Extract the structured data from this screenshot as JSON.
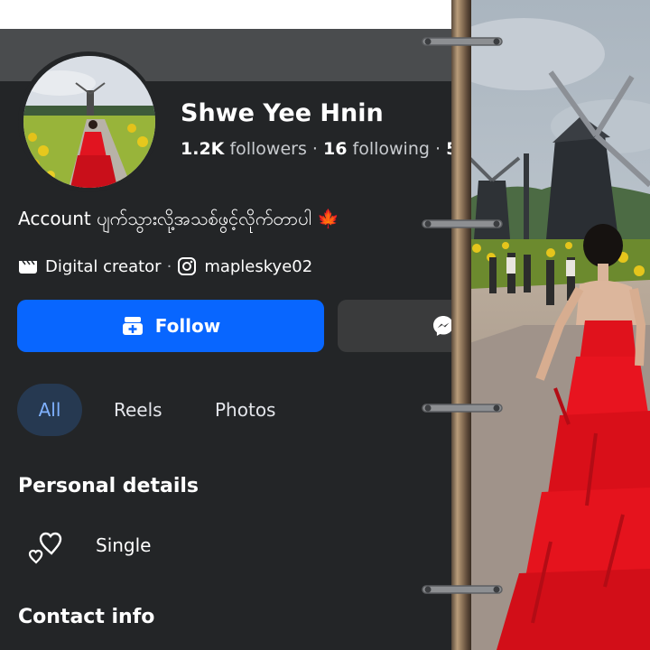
{
  "profile": {
    "name": "Shwe Yee Hnin",
    "followers_count": "1.2K",
    "followers_label": "followers",
    "following_count": "16",
    "following_label": "following",
    "stats_overflow": "5",
    "bio": "Account ပျက်သွားလို့အသစ်ဖွင့်လိုက်တာပါ",
    "bio_emoji": "🍁",
    "category": "Digital creator",
    "instagram_handle": "mapleskye02"
  },
  "actions": {
    "follow_label": "Follow"
  },
  "tabs": [
    {
      "label": "All",
      "active": true
    },
    {
      "label": "Reels",
      "active": false
    },
    {
      "label": "Photos",
      "active": false
    }
  ],
  "sections": {
    "personal_details": "Personal details",
    "relationship": "Single",
    "contact_info": "Contact info"
  },
  "colors": {
    "panel_bg": "#232527",
    "accent_blue": "#0866ff",
    "dress_red": "#e1141e"
  },
  "icons": [
    "clapperboard-icon",
    "instagram-icon",
    "add-friend-icon",
    "messenger-icon",
    "hearts-icon",
    "binder-ring-icon"
  ]
}
